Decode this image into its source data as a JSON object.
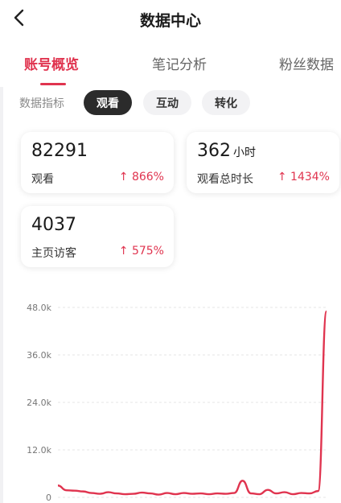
{
  "header": {
    "title": "数据中心",
    "back_icon": "chevron-left-icon"
  },
  "tabs": [
    {
      "label": "账号概览",
      "active": true
    },
    {
      "label": "笔记分析",
      "active": false
    },
    {
      "label": "粉丝数据",
      "active": false
    }
  ],
  "filters": {
    "label": "数据指标",
    "chips": [
      {
        "label": "观看",
        "active": true
      },
      {
        "label": "互动",
        "active": false
      },
      {
        "label": "转化",
        "active": false
      }
    ]
  },
  "metrics": [
    {
      "value": "82291",
      "unit": "",
      "label": "观看",
      "change": "↑ 866%"
    },
    {
      "value": "362",
      "unit": "小时",
      "label": "观看总时长",
      "change": "↑ 1434%"
    },
    {
      "value": "4037",
      "unit": "",
      "label": "主页访客",
      "change": "↑ 575%"
    }
  ],
  "colors": {
    "accent": "#e0344f",
    "chip_active_bg": "#2b2b2b",
    "chip_bg": "#f2f2f4",
    "grid": "#e6e6e6"
  },
  "chart_data": {
    "type": "line",
    "title": "",
    "xlabel": "",
    "ylabel": "",
    "ylim": [
      0,
      48000
    ],
    "y_ticks": [
      0,
      12000,
      24000,
      36000,
      48000
    ],
    "y_tick_labels": [
      "0",
      "12.0k",
      "24.0k",
      "36.0k",
      "48.0k"
    ],
    "grid": true,
    "series": [
      {
        "color": "#e0344f",
        "values": [
          3000,
          1800,
          1700,
          1500,
          1100,
          900,
          1300,
          1000,
          800,
          900,
          1200,
          1000,
          700,
          1100,
          800,
          1100,
          900,
          1000,
          800,
          1000,
          900,
          1100,
          4200,
          1000,
          800,
          1900,
          1000,
          1300,
          800,
          1100,
          1000,
          1600,
          47000
        ]
      }
    ]
  }
}
